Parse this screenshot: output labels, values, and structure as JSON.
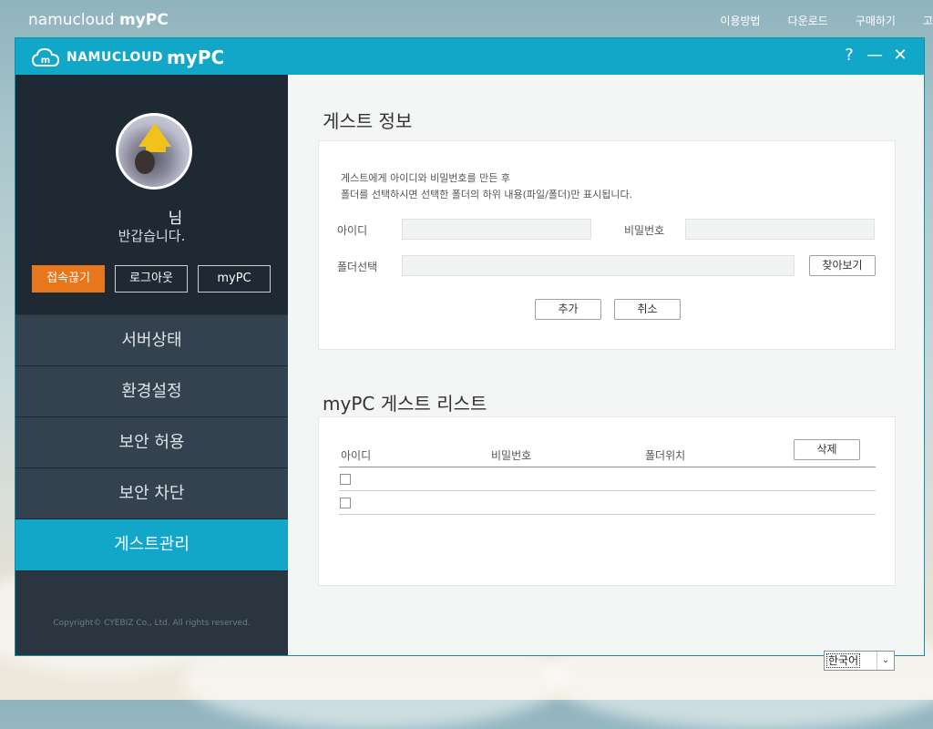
{
  "site": {
    "logo_light": "namucloud ",
    "logo_bold": "myPC",
    "nav": [
      "이용방법",
      "다운로드",
      "구매하기",
      "고"
    ]
  },
  "window": {
    "logo_part1": "NAMUCLOUD",
    "logo_part2": "myPC",
    "help": "?",
    "minimize": "—",
    "close": "✕"
  },
  "sidebar": {
    "user_suffix": "님",
    "greeting": "반갑습니다.",
    "buttons": {
      "disconnect": "접속끊기",
      "logout": "로그아웃",
      "mypc": "myPC"
    },
    "menu": [
      "서버상태",
      "환경설정",
      "보안 허용",
      "보안 차단",
      "게스트관리"
    ],
    "active_index": 4,
    "copyright": "Copyright© CYEBIZ Co., Ltd. All rights reserved."
  },
  "guest_info": {
    "title": "게스트 정보",
    "desc_line1": "게스트에게 아이디와 비밀번호를 만든 후",
    "desc_line2": "폴더를 선택하시면 선택한 폴더의 하위 내용(파일/폴더)만 표시됩니다.",
    "id_label": "아이디",
    "id_value": "",
    "pw_label": "비밀번호",
    "pw_value": "",
    "folder_label": "폴더선택",
    "folder_value": "",
    "browse_btn": "찾아보기",
    "add_btn": "추가",
    "cancel_btn": "취소"
  },
  "guest_list": {
    "title": "myPC 게스트 리스트",
    "columns": [
      "아이디",
      "비밀번호",
      "폴더위치"
    ],
    "delete_btn": "삭제",
    "rows": [
      {
        "id": "",
        "pw": "",
        "folder": ""
      },
      {
        "id": "",
        "pw": "",
        "folder": ""
      }
    ]
  },
  "language": {
    "selected": "한국어"
  },
  "colors": {
    "accent": "#12a6c9",
    "sidebar": "#2a3540",
    "disconnect": "#e8761a"
  }
}
